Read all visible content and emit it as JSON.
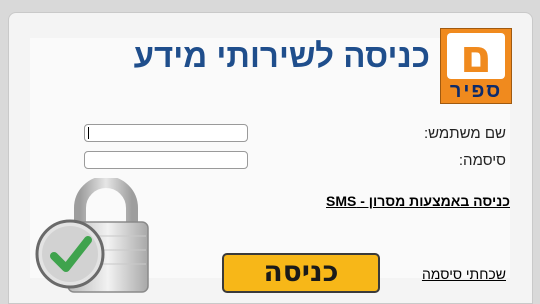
{
  "logo": {
    "letter": "ם",
    "word": "ספיר"
  },
  "header": {
    "title": "כניסה לשירותי מידע"
  },
  "form": {
    "username_label": "שם משתמש:",
    "password_label": "סיסמה:",
    "username_value": "",
    "password_value": ""
  },
  "links": {
    "sms_login": "כניסה באמצעות מסרון - SMS",
    "forgot_password": "שכחתי סיסמה"
  },
  "buttons": {
    "login_label": "כניסה"
  },
  "icons": {
    "lock_icon": "padlock-with-checkmark-icon"
  },
  "colors": {
    "title": "#1f4e8c",
    "logo_orange": "#f08a1e",
    "login_button": "#f7b718",
    "check_green": "#3fa34d"
  }
}
